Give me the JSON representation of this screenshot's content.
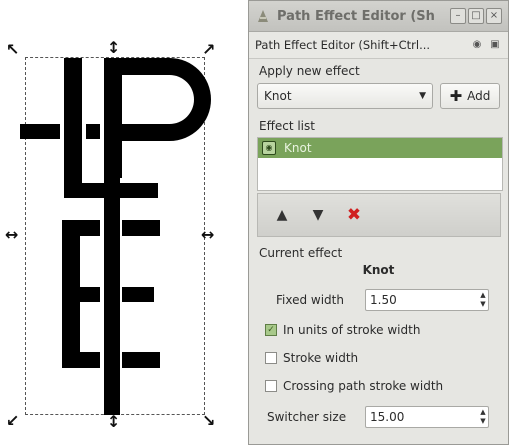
{
  "canvas": {
    "handles": {
      "nw": "↖",
      "n": "↕",
      "ne": "↗",
      "w": "↔",
      "e": "↔",
      "sw": "↙",
      "s": "↕",
      "se": "↘"
    }
  },
  "dialog": {
    "title": "Path Effect Editor (Sh",
    "header": "Path Effect Editor (Shift+Ctrl...",
    "window_buttons": [
      "–",
      "□",
      "×"
    ],
    "apply_label": "Apply new effect",
    "effect_combo_value": "Knot",
    "add_label": "Add",
    "effect_list_label": "Effect list",
    "effect_list_items": [
      "Knot"
    ],
    "current_effect_label": "Current effect",
    "current_effect_name": "Knot",
    "fixed_width_label": "Fixed width",
    "fixed_width_value": "1.50",
    "in_units_label": "In units of stroke width",
    "stroke_width_label": "Stroke width",
    "crossing_label": "Crossing path stroke width",
    "switcher_size_label": "Switcher size",
    "switcher_size_value": "15.00"
  },
  "colors": {
    "selected_row": "#7aa35b",
    "delete": "#d02020"
  }
}
